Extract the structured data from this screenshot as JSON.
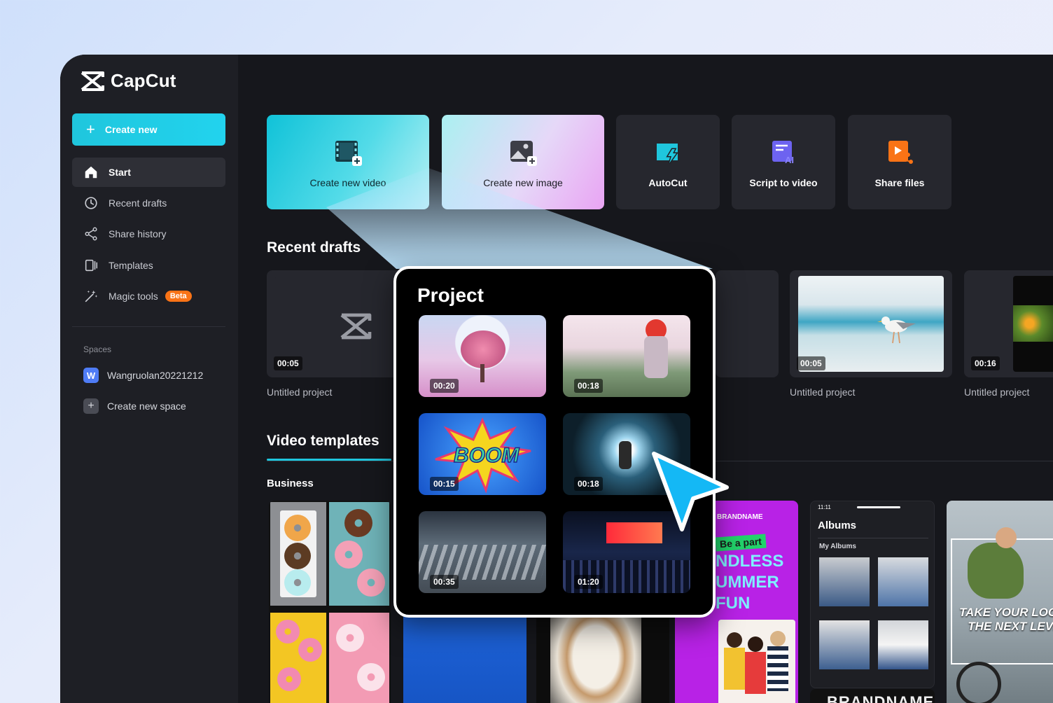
{
  "app": {
    "name": "CapCut"
  },
  "sidebar": {
    "create_new_label": "Create new",
    "items": [
      {
        "label": "Start",
        "icon": "home-icon",
        "active": true
      },
      {
        "label": "Recent drafts",
        "icon": "clock-icon"
      },
      {
        "label": "Share history",
        "icon": "share-icon"
      },
      {
        "label": "Templates",
        "icon": "templates-icon"
      },
      {
        "label": "Magic tools",
        "icon": "magic-wand-icon",
        "badge": "Beta"
      }
    ],
    "spaces_label": "Spaces",
    "spaces": [
      {
        "avatar": "W",
        "label": "Wangruolan20221212"
      }
    ],
    "create_space_label": "Create new space"
  },
  "actions": [
    {
      "label": "Create new video",
      "icon": "film-plus-icon"
    },
    {
      "label": "Create new image",
      "icon": "image-plus-icon"
    },
    {
      "label": "AutoCut",
      "icon": "autocut-icon"
    },
    {
      "label": "Script to video",
      "icon": "script-ai-icon"
    },
    {
      "label": "Share files",
      "icon": "share-files-icon"
    }
  ],
  "recent_drafts": {
    "title": "Recent drafts",
    "items": [
      {
        "label": "Untitled project",
        "duration": "00:05"
      },
      {
        "label": "Untitled project",
        "duration": "00:05"
      },
      {
        "label": "Untitled project",
        "duration": "00:16"
      }
    ]
  },
  "templates": {
    "tab": "Video templates",
    "category": "Business",
    "brand_card": {
      "brand": "BRANDNAME",
      "tag": "Be a part",
      "line1": "NDLESS",
      "line2": "UMMER",
      "line3": "FUN"
    },
    "albums_card": {
      "time": "11:11",
      "title": "Albums",
      "subtitle": "My Albums"
    },
    "bike_card": {
      "text": "TAKE YOUR LOO TO THE NEXT LEVEL"
    }
  },
  "popup": {
    "title": "Project",
    "items": [
      {
        "duration": "00:20"
      },
      {
        "duration": "00:18"
      },
      {
        "duration": "00:15",
        "text": "BOOM"
      },
      {
        "duration": "00:18"
      },
      {
        "duration": "00:35"
      },
      {
        "duration": "01:20"
      }
    ]
  },
  "colors": {
    "accent": "#1fc6dd",
    "beta": "#f97316",
    "cursor": "#14b8f5"
  }
}
